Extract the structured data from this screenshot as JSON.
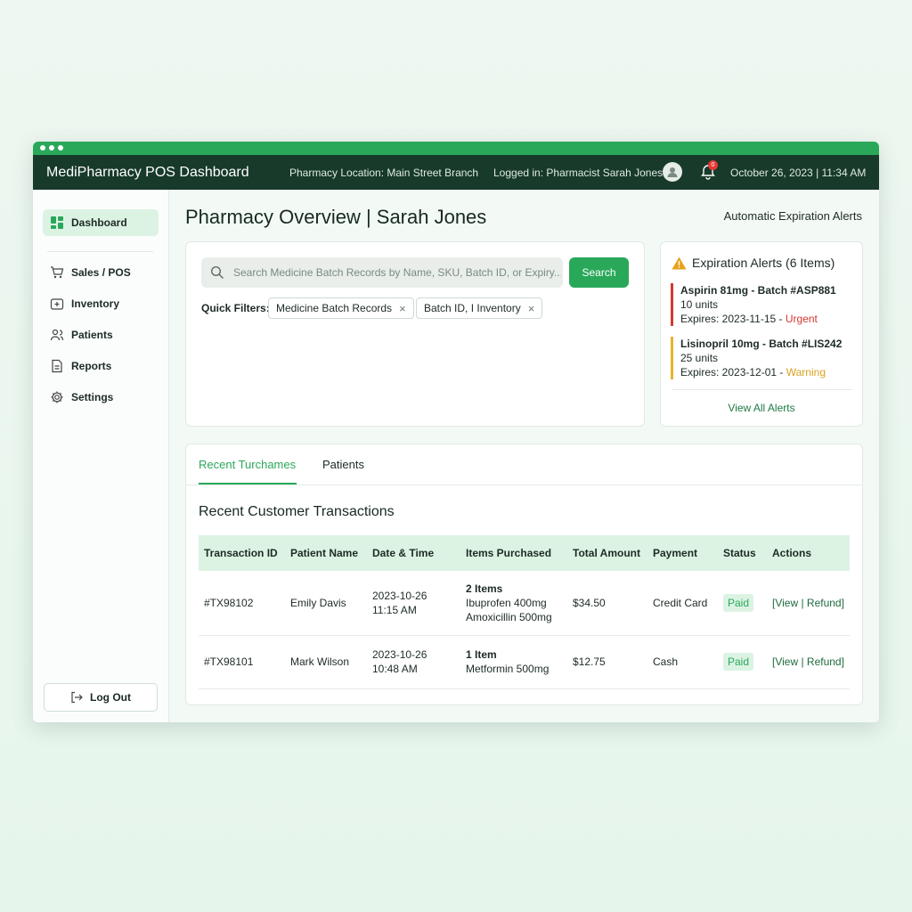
{
  "app": {
    "title": "MediPharmacy POS Dashboard",
    "location": "Pharmacy Location: Main Street Branch",
    "logged_in": "Logged in: Pharmacist Sarah Jones",
    "notification_count": "0",
    "datetime": "October 26, 2023 | 11:34 AM"
  },
  "sidebar": {
    "items": [
      {
        "label": "Dashboard",
        "icon": "dashboard-icon"
      },
      {
        "label": "Sales / POS",
        "icon": "cart-icon"
      },
      {
        "label": "Inventory",
        "icon": "box-icon"
      },
      {
        "label": "Patients",
        "icon": "users-icon"
      },
      {
        "label": "Reports",
        "icon": "document-icon"
      },
      {
        "label": "Settings",
        "icon": "gear-icon"
      }
    ],
    "logout": "Log Out"
  },
  "main": {
    "title": "Pharmacy Overview | Sarah Jones",
    "auto_alerts_label": "Automatic Expiration Alerts"
  },
  "search": {
    "placeholder": "Search Medicine Batch Records by Name, SKU, Batch ID, or Expiry...",
    "button": "Search",
    "quick_filters_label": "Quick Filters:",
    "filters": [
      "Medicine Batch Records",
      "Batch ID, I Inventory"
    ]
  },
  "alerts": {
    "title": "Expiration Alerts (6 Items)",
    "items": [
      {
        "name": "Aspirin 81mg - Batch #ASP881",
        "units": "10 units",
        "expires": "Expires: 2023-11-15 -",
        "tag": "Urgent"
      },
      {
        "name": "Lisinopril 10mg - Batch #LIS242",
        "units": "25 units",
        "expires": "Expires: 2023-12-01 -",
        "tag": "Warning"
      }
    ],
    "view_all": "View All Alerts"
  },
  "tabs": [
    "Recent Turchames",
    "Patients"
  ],
  "transactions": {
    "title": "Recent Customer Transactions",
    "columns": [
      "Transaction ID",
      "Patient Name",
      "Date & Time",
      "Items Purchased",
      "Total Amount",
      "Payment",
      "Status",
      "Actions"
    ],
    "rows": [
      {
        "id": "#TX98102",
        "patient": "Emily Davis",
        "date": "2023-10-26",
        "time": "11:15 AM",
        "items_count": "2 Items",
        "items": [
          "Ibuprofen 400mg",
          "Amoxicillin 500mg"
        ],
        "total": "$34.50",
        "payment": "Credit Card",
        "status": "Paid",
        "actions": "[View | Refund]"
      },
      {
        "id": "#TX98101",
        "patient": "Mark Wilson",
        "date": "2023-10-26",
        "time": "10:48 AM",
        "items_count": "1 Item",
        "items": [
          "Metformin 500mg"
        ],
        "total": "$12.75",
        "payment": "Cash",
        "status": "Paid",
        "actions": "[View | Refund]"
      }
    ]
  },
  "colors": {
    "accent": "#2aa85a",
    "header": "#173a2a",
    "urgent": "#d33a32",
    "warning": "#d9a21f"
  }
}
